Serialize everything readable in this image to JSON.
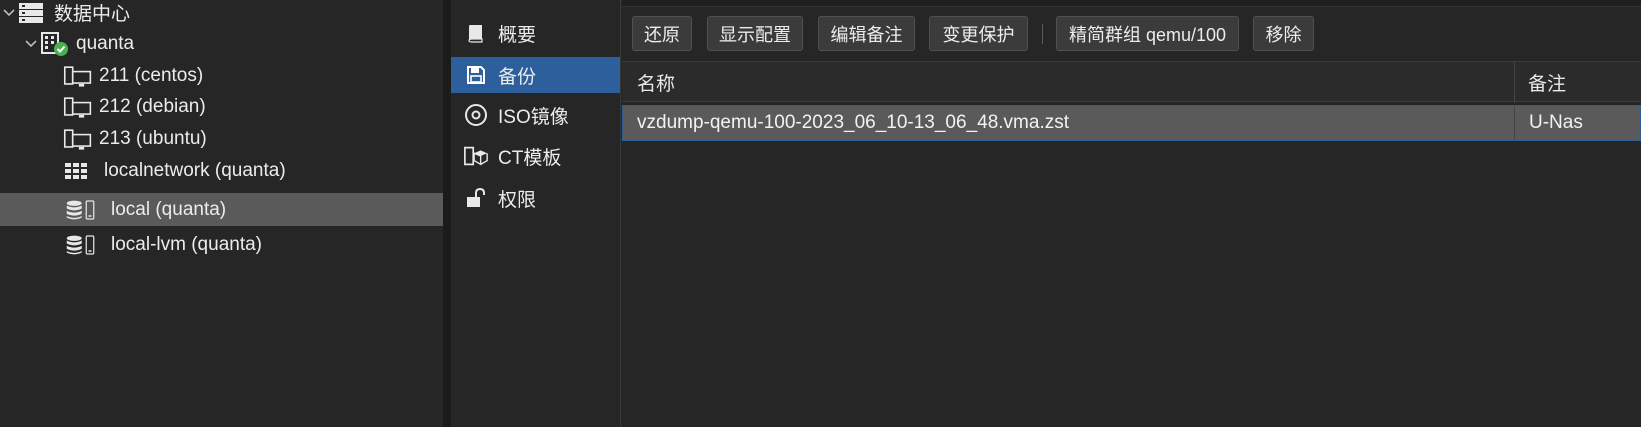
{
  "tree": {
    "datacenter": {
      "label": "数据中心",
      "icon": "server-rack-icon"
    },
    "node": {
      "label": "quanta",
      "icon": "node-online-icon",
      "status_color": "#4caf50"
    },
    "guests": [
      {
        "label": "211 (centos)",
        "icon": "vm-icon"
      },
      {
        "label": "212 (debian)",
        "icon": "vm-icon"
      },
      {
        "label": "213 (ubuntu)",
        "icon": "vm-icon"
      }
    ],
    "sdn": {
      "label": "localnetwork (quanta)",
      "icon": "network-grid-icon"
    },
    "storages": [
      {
        "label": "local (quanta)",
        "icon": "storage-icon",
        "selected": true
      },
      {
        "label": "local-lvm (quanta)",
        "icon": "storage-icon",
        "selected": false
      }
    ]
  },
  "nav": {
    "items": [
      {
        "label": "概要",
        "icon": "book-icon",
        "active": false
      },
      {
        "label": "备份",
        "icon": "floppy-disk-icon",
        "active": true
      },
      {
        "label": "ISO镜像",
        "icon": "disc-icon",
        "active": false
      },
      {
        "label": "CT模板",
        "icon": "container-template-icon",
        "active": false
      },
      {
        "label": "权限",
        "icon": "unlock-icon",
        "active": false
      }
    ]
  },
  "toolbar": {
    "restore": "还原",
    "show_config": "显示配置",
    "edit_notes": "编辑备注",
    "change_protection": "变更保护",
    "prune_group": "精简群组 qemu/100",
    "remove": "移除"
  },
  "grid": {
    "columns": {
      "name": "名称",
      "notes": "备注"
    },
    "rows": [
      {
        "name": "vzdump-qemu-100-2023_06_10-13_06_48.vma.zst",
        "notes": "U-Nas",
        "selected": true
      }
    ]
  },
  "colors": {
    "background": "#262626",
    "selection_blue": "#2d5f9c",
    "selected_row": "#5a5a5a",
    "button": "#3b3b3b"
  }
}
